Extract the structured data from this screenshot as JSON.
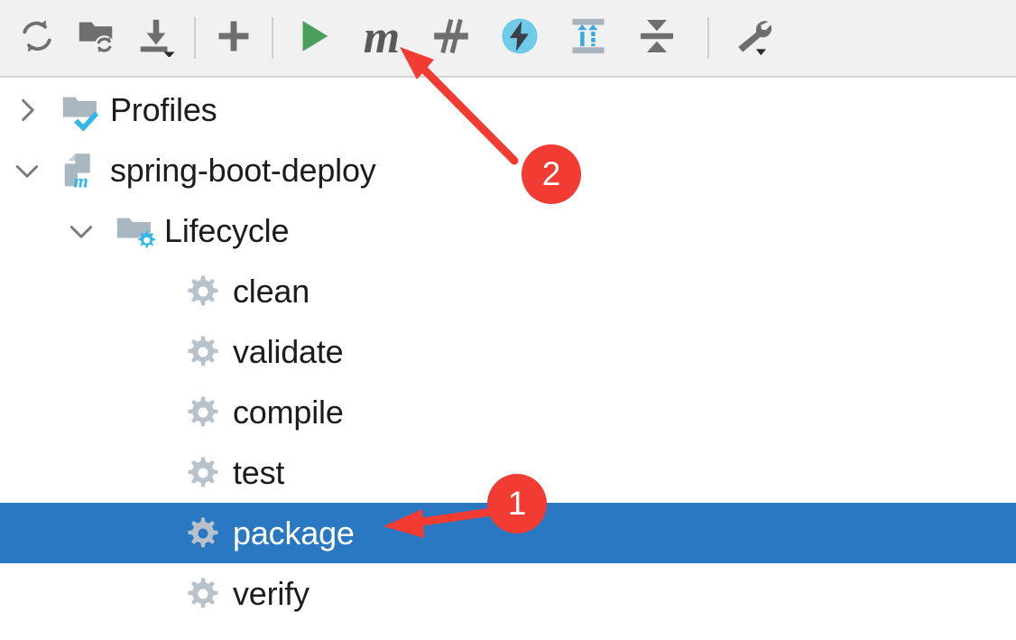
{
  "toolbar": {
    "background": "#f1f1f1",
    "items": [
      {
        "name": "reload-all-maven-projects-icon",
        "label": "Reload All Maven Projects",
        "icon": "refresh-icon"
      },
      {
        "name": "generate-sources-icon",
        "label": "Generate Sources and Update Folders For All Projects",
        "icon": "folder-refresh-icon"
      },
      {
        "name": "download-sources-icon",
        "label": "Download Sources and/or Documentation",
        "icon": "download-arrow-icon"
      },
      {
        "name": "separator-1",
        "label": "",
        "icon": "separator"
      },
      {
        "name": "add-maven-project-icon",
        "label": "Add Maven Project",
        "icon": "plus-icon"
      },
      {
        "name": "separator-2",
        "label": "",
        "icon": "separator"
      },
      {
        "name": "run-maven-build-icon",
        "label": "Run Maven Build",
        "icon": "play-icon"
      },
      {
        "name": "execute-maven-goal-icon",
        "label": "Execute Maven Goal",
        "icon": "maven-m-icon"
      },
      {
        "name": "toggle-skip-tests-icon",
        "label": "Toggle 'Skip Tests' Mode",
        "icon": "skip-tests-icon"
      },
      {
        "name": "toggle-offline-mode-icon",
        "label": "Toggle Offline Mode",
        "icon": "lightning-bolt-icon"
      },
      {
        "name": "expand-all-icon",
        "label": "Expand All",
        "icon": "expand-all-icon"
      },
      {
        "name": "collapse-all-icon",
        "label": "Collapse All",
        "icon": "collapse-all-icon"
      },
      {
        "name": "separator-3",
        "label": "",
        "icon": "separator"
      },
      {
        "name": "maven-settings-icon",
        "label": "Maven Settings",
        "icon": "wrench-icon"
      }
    ]
  },
  "tree": {
    "selection_color": "#2a78c2",
    "rows": [
      {
        "label": "Profiles",
        "level": 1,
        "chevron": "collapsed",
        "icon": "profiles-folder-icon",
        "selected": false
      },
      {
        "label": "spring-boot-deploy",
        "level": 1,
        "chevron": "expanded",
        "icon": "maven-module-icon",
        "selected": false
      },
      {
        "label": "Lifecycle",
        "level": 2,
        "chevron": "expanded",
        "icon": "lifecycle-folder-icon",
        "selected": false
      },
      {
        "label": "clean",
        "level": 3,
        "chevron": "none",
        "icon": "goal-gear-icon",
        "selected": false
      },
      {
        "label": "validate",
        "level": 3,
        "chevron": "none",
        "icon": "goal-gear-icon",
        "selected": false
      },
      {
        "label": "compile",
        "level": 3,
        "chevron": "none",
        "icon": "goal-gear-icon",
        "selected": false
      },
      {
        "label": "test",
        "level": 3,
        "chevron": "none",
        "icon": "goal-gear-icon",
        "selected": false
      },
      {
        "label": "package",
        "level": 3,
        "chevron": "none",
        "icon": "goal-gear-icon",
        "selected": true
      },
      {
        "label": "verify",
        "level": 3,
        "chevron": "none",
        "icon": "goal-gear-icon",
        "selected": false
      }
    ]
  },
  "annotations": {
    "color": "#f23b32",
    "badges": [
      {
        "name": "annotation-badge-1",
        "text": "1",
        "points_at": "package"
      },
      {
        "name": "annotation-badge-2",
        "text": "2",
        "points_at": "run-maven-build-icon"
      }
    ]
  }
}
